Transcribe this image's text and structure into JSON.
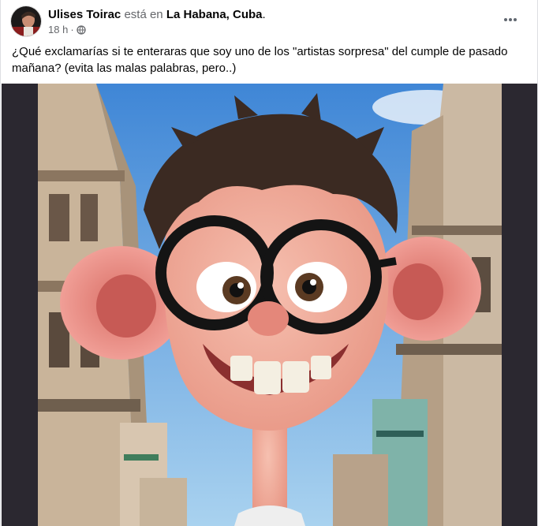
{
  "post": {
    "author": "Ulises Toirac",
    "connector": "está en",
    "location": "La Habana, Cuba",
    "location_suffix": ".",
    "time": "18 h",
    "privacy_icon": "globe-icon",
    "menu_icon": "more-dots-icon",
    "text": "¿Qué exclamarías si te enteraras que soy uno de los \"artistas sorpresa\" del cumple de pasado mañana? (evita las malas palabras, pero..)"
  },
  "colors": {
    "text": "#050505",
    "secondary": "#65676b",
    "sky": "#5a9ad8",
    "skin": "#f2a79a"
  }
}
